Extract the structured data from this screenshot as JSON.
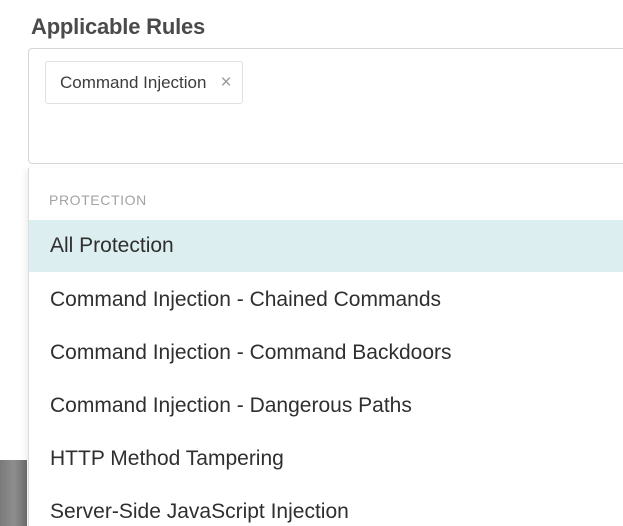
{
  "field": {
    "label": "Applicable Rules"
  },
  "selected_chips": [
    {
      "label": "Command Injection",
      "remove_glyph": "×"
    }
  ],
  "dropdown": {
    "group_header": "PROTECTION",
    "highlight_color": "#ddeef0",
    "options": [
      {
        "label": "All Protection",
        "highlighted": true
      },
      {
        "label": "Command Injection - Chained Commands",
        "highlighted": false
      },
      {
        "label": "Command Injection - Command Backdoors",
        "highlighted": false
      },
      {
        "label": "Command Injection - Dangerous Paths",
        "highlighted": false
      },
      {
        "label": "HTTP Method Tampering",
        "highlighted": false
      },
      {
        "label": "Server-Side JavaScript Injection",
        "highlighted": false
      }
    ]
  }
}
